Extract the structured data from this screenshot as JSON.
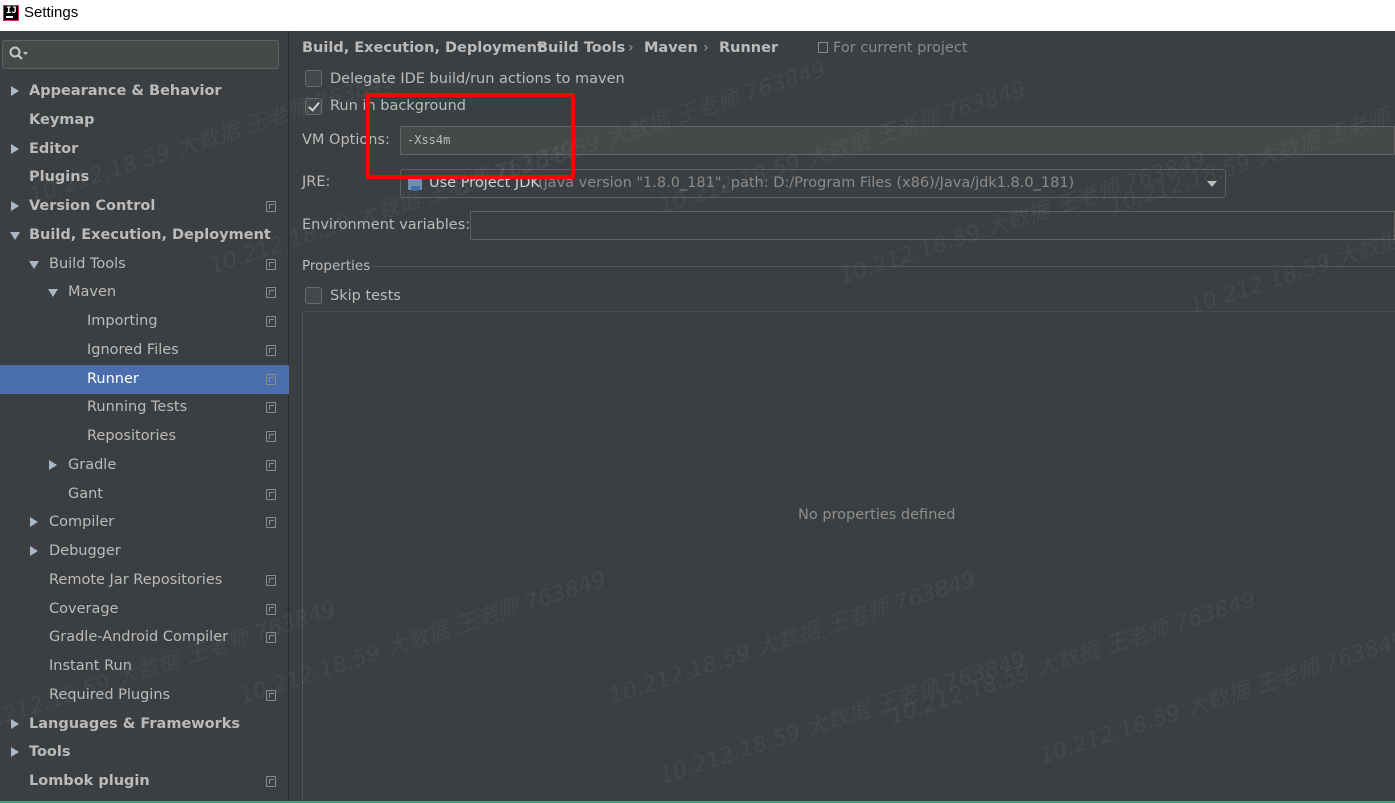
{
  "window": {
    "title": "Settings",
    "logo_text": "IJ"
  },
  "search": {
    "value": "",
    "placeholder": ""
  },
  "tree": [
    {
      "label": "Appearance & Behavior",
      "bold": true,
      "arrow": "right",
      "icon": false
    },
    {
      "label": "Keymap",
      "bold": true,
      "arrow": "none",
      "icon": false
    },
    {
      "label": "Editor",
      "bold": true,
      "arrow": "right",
      "icon": false
    },
    {
      "label": "Plugins",
      "bold": true,
      "arrow": "none",
      "icon": false
    },
    {
      "label": "Version Control",
      "bold": true,
      "arrow": "right",
      "icon": true
    },
    {
      "label": "Build, Execution, Deployment",
      "bold": true,
      "arrow": "down",
      "icon": false
    },
    {
      "label": "Build Tools",
      "bold": false,
      "arrow": "down",
      "icon": true
    },
    {
      "label": "Maven",
      "bold": false,
      "arrow": "down",
      "icon": true
    },
    {
      "label": "Importing",
      "bold": false,
      "arrow": "none",
      "icon": true
    },
    {
      "label": "Ignored Files",
      "bold": false,
      "arrow": "none",
      "icon": true
    },
    {
      "label": "Runner",
      "bold": false,
      "arrow": "none",
      "icon": true,
      "selected": true
    },
    {
      "label": "Running Tests",
      "bold": false,
      "arrow": "none",
      "icon": true
    },
    {
      "label": "Repositories",
      "bold": false,
      "arrow": "none",
      "icon": true
    },
    {
      "label": "Gradle",
      "bold": false,
      "arrow": "right",
      "icon": true
    },
    {
      "label": "Gant",
      "bold": false,
      "arrow": "none",
      "icon": true
    },
    {
      "label": "Compiler",
      "bold": false,
      "arrow": "right",
      "icon": true
    },
    {
      "label": "Debugger",
      "bold": false,
      "arrow": "right",
      "icon": false
    },
    {
      "label": "Remote Jar Repositories",
      "bold": false,
      "arrow": "none",
      "icon": true
    },
    {
      "label": "Coverage",
      "bold": false,
      "arrow": "none",
      "icon": true
    },
    {
      "label": "Gradle-Android Compiler",
      "bold": false,
      "arrow": "none",
      "icon": true
    },
    {
      "label": "Instant Run",
      "bold": false,
      "arrow": "none",
      "icon": false
    },
    {
      "label": "Required Plugins",
      "bold": false,
      "arrow": "none",
      "icon": true
    },
    {
      "label": "Languages & Frameworks",
      "bold": true,
      "arrow": "right",
      "icon": false
    },
    {
      "label": "Tools",
      "bold": true,
      "arrow": "right",
      "icon": false
    },
    {
      "label": "Lombok plugin",
      "bold": true,
      "arrow": "none",
      "icon": true
    }
  ],
  "breadcrumb": {
    "items": [
      "Build, Execution, Deployment",
      "Build Tools",
      "Maven",
      "Runner"
    ],
    "separator": "›",
    "scope": "For current project"
  },
  "runner": {
    "delegate_label": "Delegate IDE build/run actions to maven",
    "delegate_checked": false,
    "background_label": "Run in background",
    "background_checked": true,
    "vm_options_label": "VM Options:",
    "vm_options_value": "-Xss4m",
    "jre_label": "JRE:",
    "jre_primary": "Use Project JDK",
    "jre_secondary": "(java version \"1.8.0_181\", path: D:/Program Files (x86)/Java/jdk1.8.0_181)",
    "env_label": "Environment variables:",
    "env_value": ""
  },
  "properties": {
    "title": "Properties",
    "skip_tests_label": "Skip tests",
    "skip_tests_checked": false,
    "empty_text": "No properties defined"
  },
  "watermark": {
    "text": "10.212.18.59 大数据 王老师 763849"
  },
  "colors": {
    "selection": "#4b6eaf",
    "highlight": "#ff0000",
    "background": "#3c3f41"
  }
}
